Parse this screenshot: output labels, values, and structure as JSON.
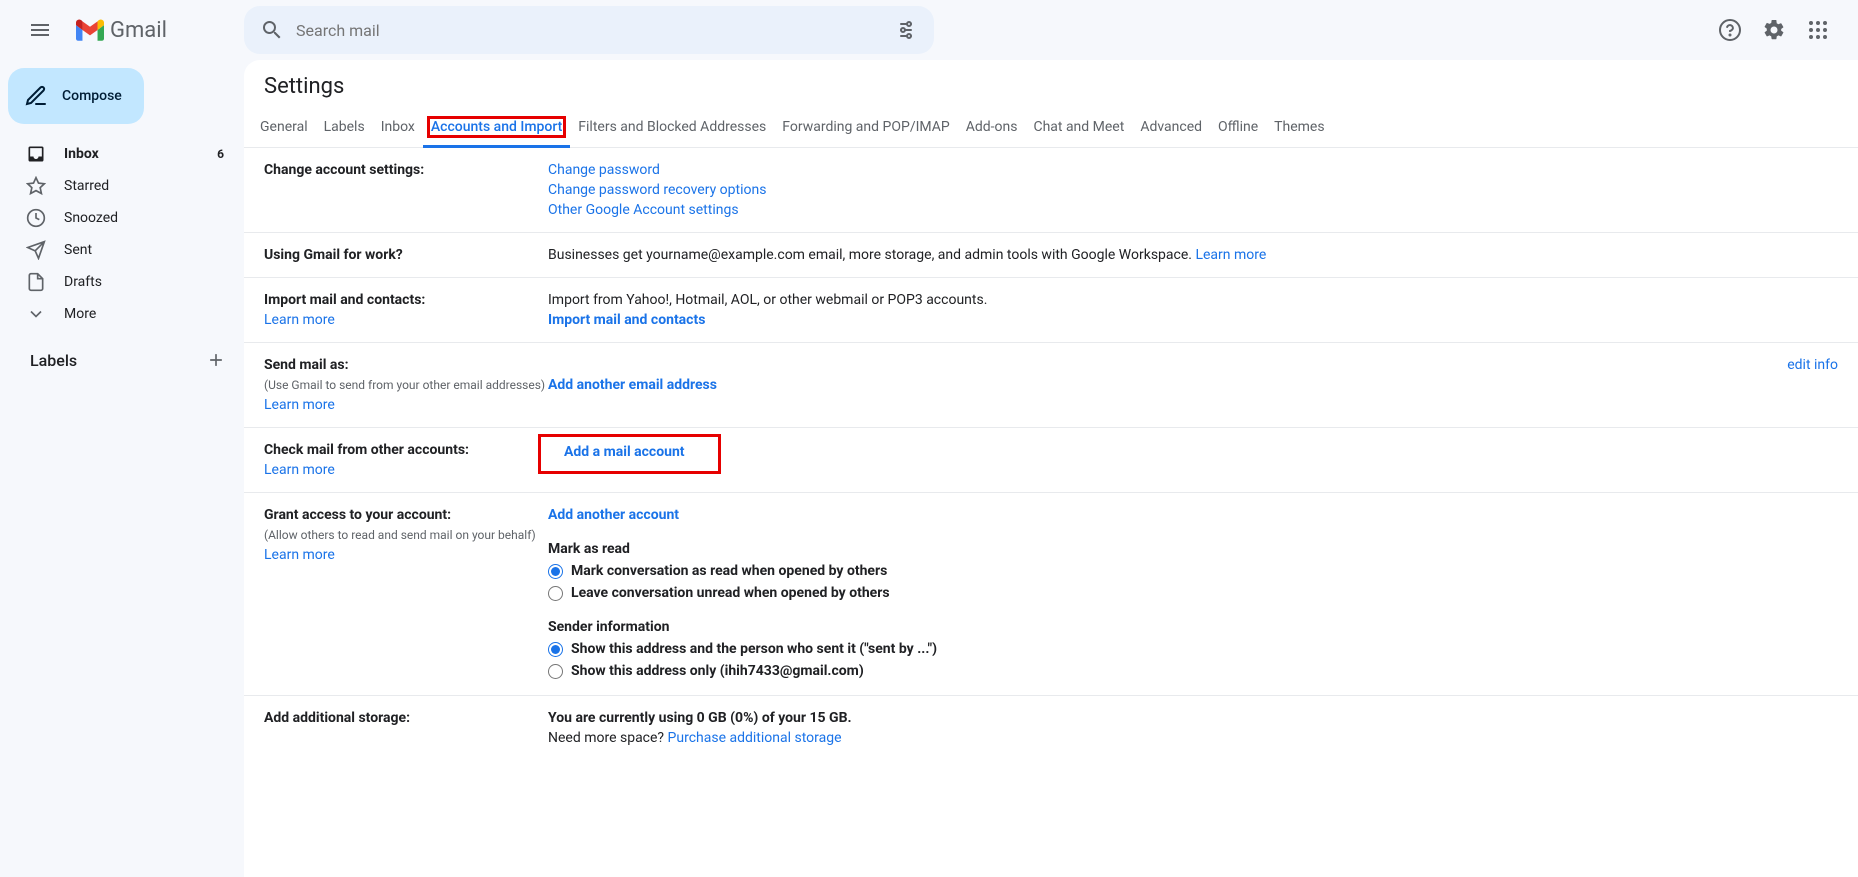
{
  "header": {
    "logo_text": "Gmail",
    "search_placeholder": "Search mail"
  },
  "compose_label": "Compose",
  "nav": [
    {
      "label": "Inbox",
      "count": "6",
      "bold": true,
      "icon": "inbox"
    },
    {
      "label": "Starred",
      "icon": "star"
    },
    {
      "label": "Snoozed",
      "icon": "clock"
    },
    {
      "label": "Sent",
      "icon": "send"
    },
    {
      "label": "Drafts",
      "icon": "file"
    },
    {
      "label": "More",
      "icon": "chevron-down"
    }
  ],
  "labels_heading": "Labels",
  "settings_title": "Settings",
  "tabs": [
    "General",
    "Labels",
    "Inbox",
    "Accounts and Import",
    "Filters and Blocked Addresses",
    "Forwarding and POP/IMAP",
    "Add-ons",
    "Chat and Meet",
    "Advanced",
    "Offline",
    "Themes"
  ],
  "active_tab_index": 3,
  "sections": {
    "change_account": {
      "label": "Change account settings:",
      "links": [
        "Change password",
        "Change password recovery options",
        "Other Google Account settings"
      ]
    },
    "using_work": {
      "label": "Using Gmail for work?",
      "desc": "Businesses get yourname@example.com email, more storage, and admin tools with Google Workspace. ",
      "learn_more": "Learn more"
    },
    "import_mail": {
      "label": "Import mail and contacts:",
      "learn_more": "Learn more",
      "desc": "Import from Yahoo!, Hotmail, AOL, or other webmail or POP3 accounts.",
      "action": "Import mail and contacts"
    },
    "send_mail_as": {
      "label": "Send mail as:",
      "sub": "(Use Gmail to send from your other email addresses)",
      "learn_more": "Learn more",
      "action": "Add another email address",
      "edit_info": "edit info"
    },
    "check_mail": {
      "label": "Check mail from other accounts:",
      "learn_more": "Learn more",
      "action": "Add a mail account"
    },
    "grant_access": {
      "label": "Grant access to your account:",
      "sub": "(Allow others to read and send mail on your behalf)",
      "learn_more": "Learn more",
      "action": "Add another account",
      "mark_as_read_hdr": "Mark as read",
      "mark_opt1": "Mark conversation as read when opened by others",
      "mark_opt2": "Leave conversation unread when opened by others",
      "sender_hdr": "Sender information",
      "sender_opt1": "Show this address and the person who sent it (\"sent by ...\")",
      "sender_opt2": "Show this address only (ihih7433@gmail.com)"
    },
    "storage": {
      "label": "Add additional storage:",
      "desc": "You are currently using 0 GB (0%) of your 15 GB.",
      "need": "Need more space? ",
      "purchase": "Purchase additional storage"
    }
  }
}
